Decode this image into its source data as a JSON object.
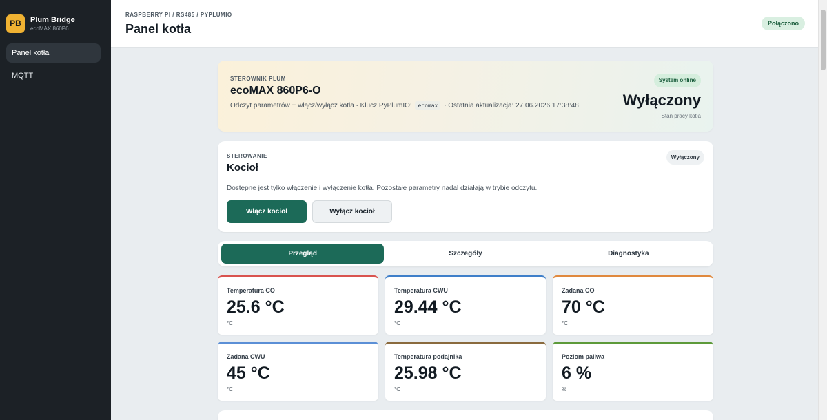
{
  "sidebar": {
    "logo_text": "PB",
    "brand_name": "Plum Bridge",
    "brand_sub": "ecoMAX 860P6",
    "items": [
      {
        "label": "Panel kotła",
        "active": true
      },
      {
        "label": "MQTT",
        "active": false
      }
    ]
  },
  "header": {
    "breadcrumb": "RASPBERRY PI / RS485 / PYPLUMIO",
    "title": "Panel kotła",
    "connection": "Połączono"
  },
  "hero": {
    "eyebrow": "STEROWNIK PLUM",
    "title": "ecoMAX 860P6-O",
    "desc_prefix": "Odczyt parametrów + włącz/wyłącz kotła · Klucz PyPlumIO:",
    "desc_code": "ecomax",
    "desc_suffix": "· Ostatnia aktualizacja: 27.06.2026 17:38:48",
    "online": "System online",
    "status": "Wyłączony",
    "status_label": "Stan pracy kotła"
  },
  "control": {
    "eyebrow": "STEROWANIE",
    "title": "Kocioł",
    "state": "Wyłączony",
    "desc": "Dostępne jest tylko włączenie i wyłączenie kotła. Pozostałe parametry nadal działają w trybie odczytu.",
    "btn_on": "Włącz kocioł",
    "btn_off": "Wyłącz kocioł"
  },
  "tabs": [
    {
      "label": "Przegląd",
      "active": true
    },
    {
      "label": "Szczegóły",
      "active": false
    },
    {
      "label": "Diagnostyka",
      "active": false
    }
  ],
  "metrics": [
    {
      "label": "Temperatura CO",
      "value": "25.6 °C",
      "unit": "°C",
      "accent": "#d9534f"
    },
    {
      "label": "Temperatura CWU",
      "value": "29.44 °C",
      "unit": "°C",
      "accent": "#3f7fc9"
    },
    {
      "label": "Zadana CO",
      "value": "70 °C",
      "unit": "°C",
      "accent": "#e0893e"
    },
    {
      "label": "Zadana CWU",
      "value": "45 °C",
      "unit": "°C",
      "accent": "#5b8fd6"
    },
    {
      "label": "Temperatura podajnika",
      "value": "25.98 °C",
      "unit": "°C",
      "accent": "#8a6a3e"
    },
    {
      "label": "Poziom paliwa",
      "value": "6 %",
      "unit": "%",
      "accent": "#5d9a3a"
    }
  ],
  "colors": {
    "primary": "#1c6a58",
    "sidebar_bg": "#1c2126",
    "logo_bg": "#f0b232",
    "page_bg": "#e9edf0"
  }
}
